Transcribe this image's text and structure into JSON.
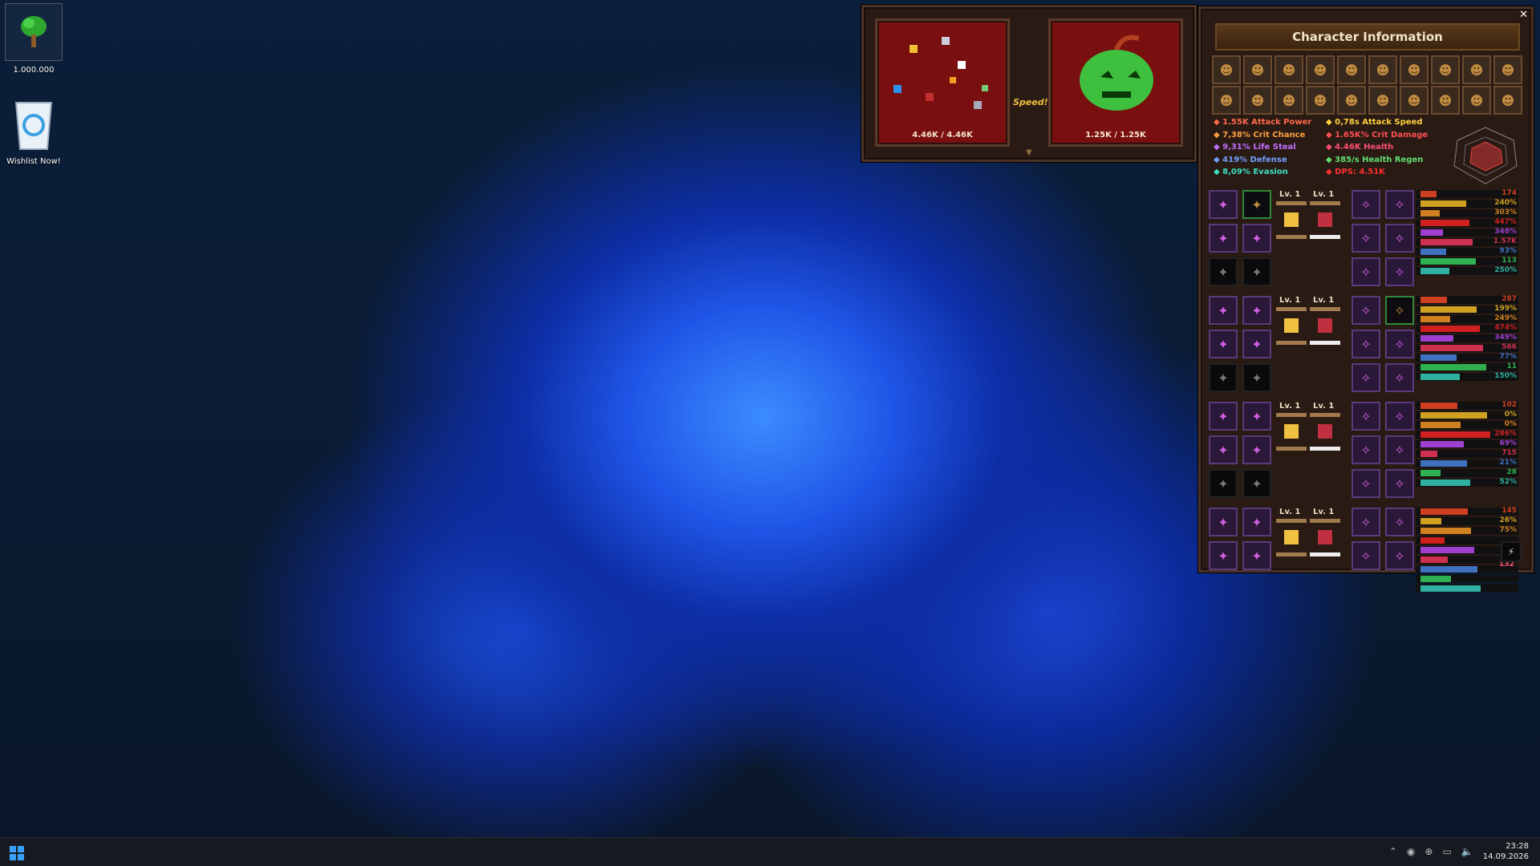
{
  "desktop": {
    "icons": [
      {
        "label": "1.000.000",
        "icon": "tree-icon"
      },
      {
        "label": "Wishlist Now!",
        "icon": "recycle-bin-icon"
      }
    ]
  },
  "game": {
    "left_panel_counter": "4.46K / 4.46K",
    "right_panel_counter": "1.25K / 1.25K",
    "speed_label": "Speed!",
    "expand": "▼"
  },
  "char": {
    "title": "Character Information",
    "close": "✕",
    "stats": [
      {
        "text": "1.55K Attack Power",
        "color": "#ff6a4a",
        "icon": "sword-icon"
      },
      {
        "text": "0,78s Attack Speed",
        "color": "#ffd040",
        "icon": "lightning-icon"
      },
      {
        "text": "7,38% Crit Chance",
        "color": "#ffa040",
        "icon": "crit-icon"
      },
      {
        "text": "1.65K% Crit Damage",
        "color": "#ff5050",
        "icon": "starburst-icon"
      },
      {
        "text": "9,31% Life Steal",
        "color": "#c070ff",
        "icon": "drop-icon"
      },
      {
        "text": "4.46K Health",
        "color": "#ff5070",
        "icon": "heart-icon"
      },
      {
        "text": "419% Defense",
        "color": "#70a0ff",
        "icon": "shield-icon"
      },
      {
        "text": "385/s Health Regen",
        "color": "#60e070",
        "icon": "regen-heart-icon"
      },
      {
        "text": "8,09% Evasion",
        "color": "#40e0c0",
        "icon": "evasion-icon"
      },
      {
        "text": "DPS: 4.51K",
        "color": "#ff3030",
        "icon": "fire-icon"
      }
    ],
    "level_label": "Lv. 1",
    "groups": [
      {
        "values": [
          "174",
          "240%",
          "303%",
          "447%",
          "348%",
          "1.57K",
          "93%",
          "113",
          "250%"
        ]
      },
      {
        "values": [
          "287",
          "199%",
          "249%",
          "474%",
          "349%",
          "566",
          "77%",
          "11",
          "150%"
        ]
      },
      {
        "values": [
          "102",
          "0%",
          "0%",
          "286%",
          "69%",
          "715",
          "21%",
          "28",
          "52%"
        ]
      },
      {
        "values": [
          "145",
          "26%",
          "75%",
          "",
          "",
          "",
          "",
          "",
          ""
        ]
      }
    ],
    "last_value": "132",
    "bar_colors": [
      "#d04020",
      "#d0a020",
      "#d08020",
      "#d02020",
      "#a040d0",
      "#d03050",
      "#4070c0",
      "#30b050",
      "#30b0a0"
    ]
  },
  "taskbar": {
    "time": "23:28",
    "date": "14.09.2026",
    "tray_icons": [
      "chevron-up-icon",
      "steam-icon",
      "network-icon",
      "display-icon",
      "volume-icon"
    ]
  }
}
